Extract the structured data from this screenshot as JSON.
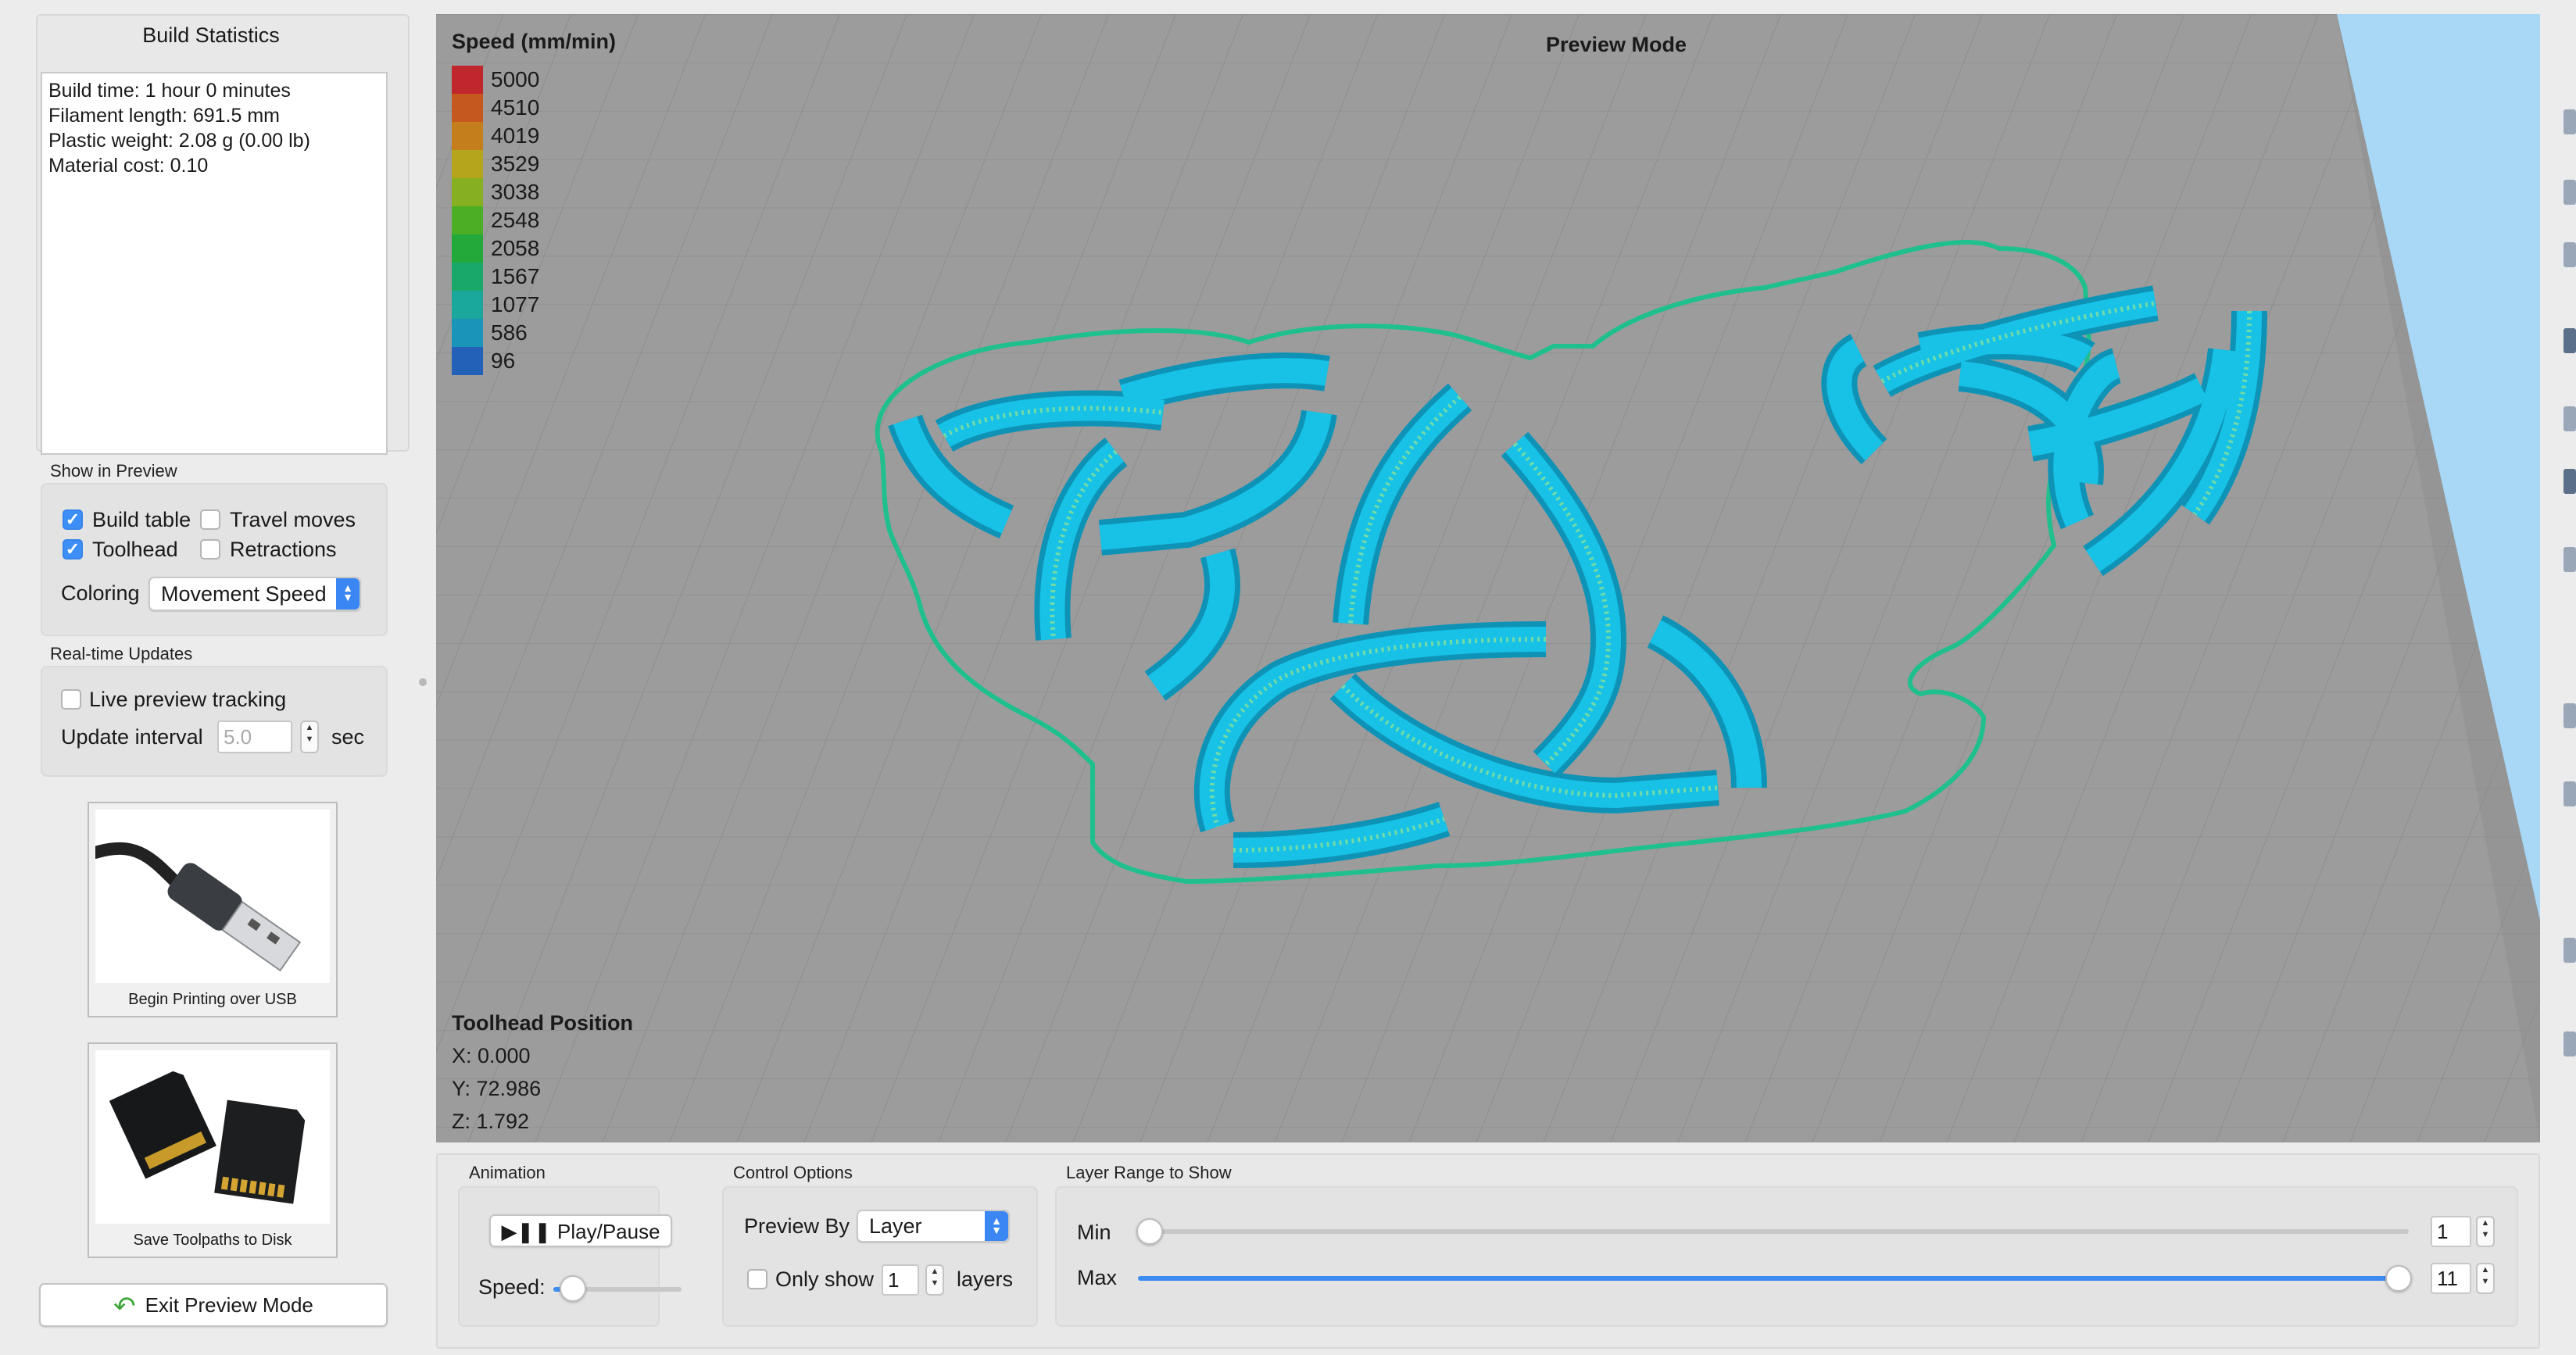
{
  "build_statistics": {
    "title": "Build Statistics",
    "lines": [
      "Build time: 1 hour 0 minutes",
      "Filament length: 691.5 mm",
      "Plastic weight: 2.08 g (0.00 lb)",
      "Material cost: 0.10"
    ]
  },
  "show_in_preview": {
    "label": "Show in Preview",
    "build_table": {
      "label": "Build table",
      "checked": true
    },
    "travel_moves": {
      "label": "Travel moves",
      "checked": false
    },
    "toolhead": {
      "label": "Toolhead",
      "checked": true
    },
    "retractions": {
      "label": "Retractions",
      "checked": false
    },
    "coloring_label": "Coloring",
    "coloring_value": "Movement Speed"
  },
  "realtime": {
    "label": "Real-time Updates",
    "live_tracking": {
      "label": "Live preview tracking",
      "checked": false
    },
    "interval_label": "Update interval",
    "interval_placeholder": "5.0",
    "interval_unit": "sec"
  },
  "actions": {
    "usb_caption": "Begin Printing over USB",
    "disk_caption": "Save Toolpaths to Disk",
    "exit_label": "Exit Preview Mode"
  },
  "viewport": {
    "mode_title": "Preview Mode",
    "legend_title": "Speed (mm/min)",
    "legend": [
      {
        "value": "5000",
        "color": "#c0272d"
      },
      {
        "value": "4510",
        "color": "#c4581f"
      },
      {
        "value": "4019",
        "color": "#c47f1c"
      },
      {
        "value": "3529",
        "color": "#b5a51d"
      },
      {
        "value": "3038",
        "color": "#86b021"
      },
      {
        "value": "2548",
        "color": "#4bae25"
      },
      {
        "value": "2058",
        "color": "#22a93a"
      },
      {
        "value": "1567",
        "color": "#1aa86a"
      },
      {
        "value": "1077",
        "color": "#1aa89c"
      },
      {
        "value": "586",
        "color": "#1a94b8"
      },
      {
        "value": "96",
        "color": "#2361b8"
      }
    ],
    "toolhead": {
      "title": "Toolhead Position",
      "x": "X: 0.000",
      "y": "Y: 72.986",
      "z": "Z: 1.792"
    }
  },
  "animation": {
    "label": "Animation",
    "play_label": "Play/Pause",
    "speed_label": "Speed:",
    "speed_level": 0.15
  },
  "control_options": {
    "label": "Control Options",
    "preview_by_label": "Preview By",
    "preview_by_value": "Layer",
    "only_show_label": "Only show",
    "only_show_value": "1",
    "only_show_checked": false,
    "layers_label": "layers"
  },
  "layer_range": {
    "label": "Layer Range to Show",
    "min_label": "Min",
    "min_value": "1",
    "max_label": "Max",
    "max_value": "11"
  },
  "colors": {
    "accent": "#3d8cf3",
    "part": "#16b9dc",
    "outline": "#1fc08e",
    "bed": "#9c9c9c"
  }
}
